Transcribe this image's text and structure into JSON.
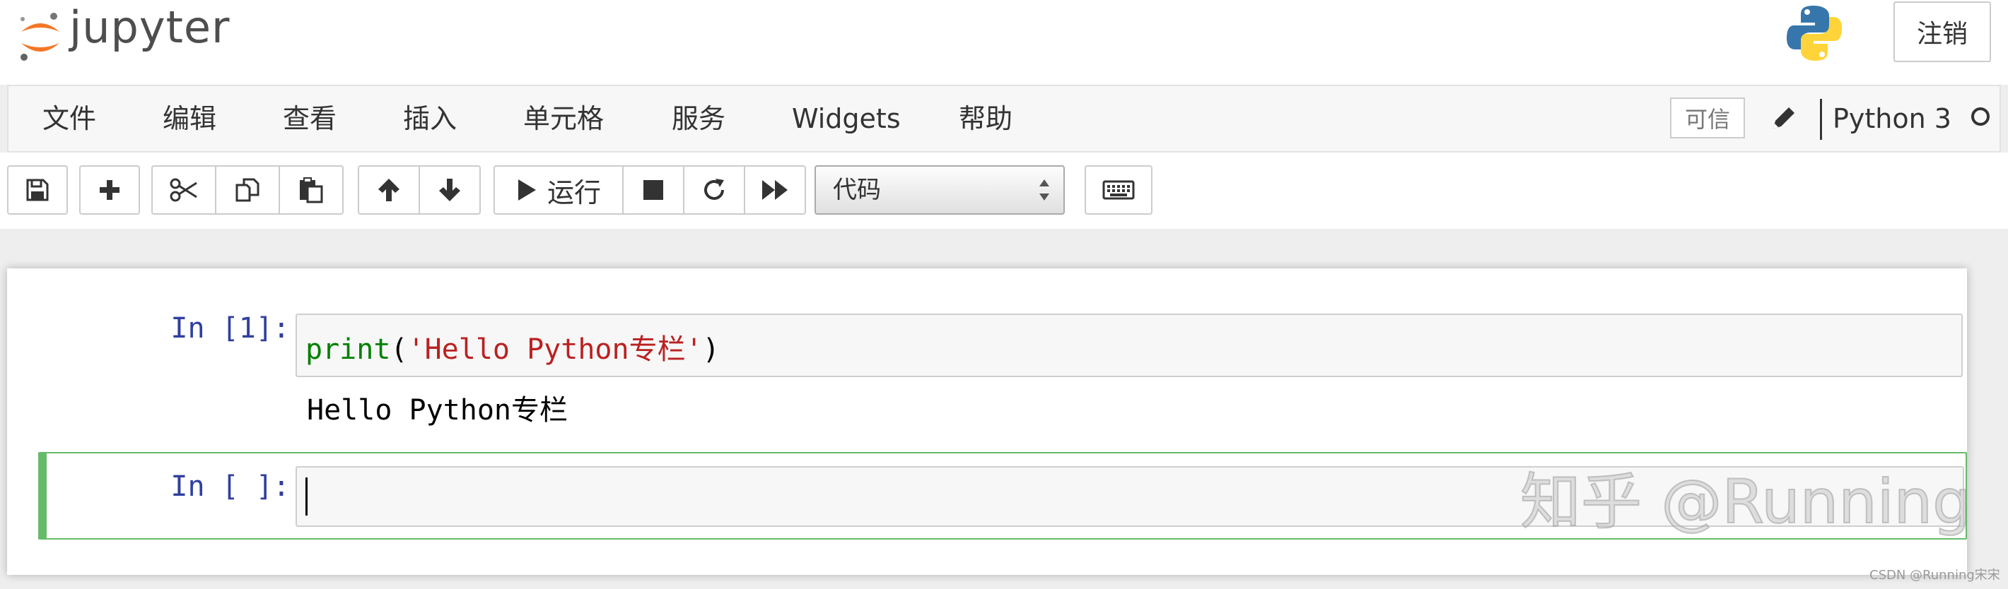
{
  "header": {
    "logo_text": "jupyter",
    "logout_label": "注销"
  },
  "menubar": {
    "items": [
      "文件",
      "编辑",
      "查看",
      "插入",
      "单元格",
      "服务",
      "Widgets",
      "帮助"
    ],
    "trusted_label": "可信",
    "kernel_name": "Python 3"
  },
  "toolbar": {
    "run_label": "运行",
    "cell_type": "代码",
    "cell_type_options": [
      "代码"
    ]
  },
  "notebook": {
    "cells": [
      {
        "prompt": "In [1]:",
        "code": {
          "fn": "print",
          "open": "(",
          "arg": "'Hello Python专栏'",
          "close": ")"
        },
        "output": "Hello Python专栏"
      },
      {
        "prompt": "In [ ]:",
        "code": "",
        "selected": true,
        "mode": "edit"
      }
    ]
  },
  "watermark": "知乎 @Running",
  "credit": "CSDN @Running宋宋",
  "colors": {
    "prompt": "#303f9f",
    "builtin": "#008000",
    "string": "#ba2121",
    "selected_cell_border": "#66bb6a"
  }
}
